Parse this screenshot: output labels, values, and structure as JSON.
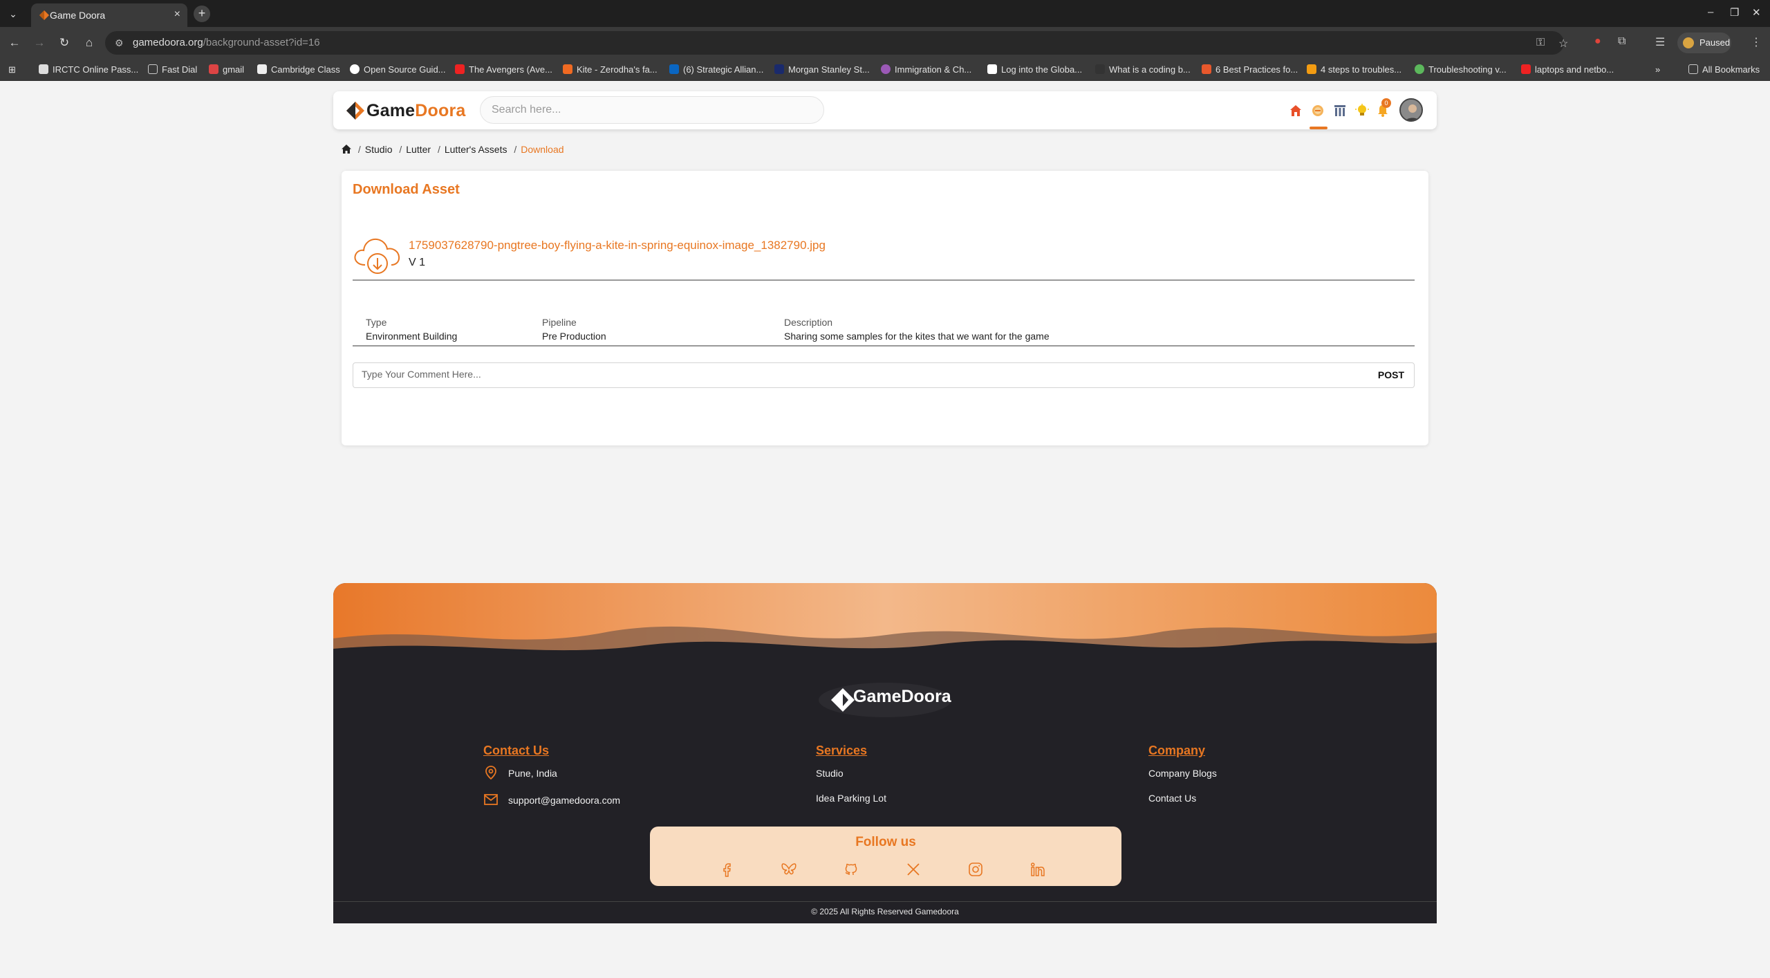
{
  "browser": {
    "tab_title": "Game Doora",
    "url_domain": "gamedoora.org",
    "url_path": "/background-asset?id=16",
    "profile_status": "Paused",
    "bookmarks": [
      "IRCTC Online Pass...",
      "Fast Dial",
      "gmail",
      "Cambridge Class",
      "Open Source Guid...",
      "The Avengers (Ave...",
      "Kite - Zerodha's fa...",
      "(6) Strategic Allian...",
      "Morgan Stanley St...",
      "Immigration & Ch...",
      "Log into the Globa...",
      "What is a coding b...",
      "6 Best Practices fo...",
      "4 steps to troubles...",
      "Troubleshooting v...",
      "laptops and netbo..."
    ],
    "all_bookmarks": "All Bookmarks"
  },
  "header": {
    "logo_part1": "Game",
    "logo_part2": "Doora",
    "search_placeholder": "Search here...",
    "notification_count": "0"
  },
  "breadcrumb": {
    "items": [
      "Studio",
      "Lutter",
      "Lutter's Assets"
    ],
    "current": "Download"
  },
  "asset": {
    "title": "Download Asset",
    "filename": "1759037628790-pngtree-boy-flying-a-kite-in-spring-equinox-image_1382790.jpg",
    "version": "V 1",
    "type_label": "Type",
    "type_value": "Environment Building",
    "pipeline_label": "Pipeline",
    "pipeline_value": "Pre Production",
    "description_label": "Description",
    "description_value": "Sharing some samples for the kites that we want for the game",
    "comment_placeholder": "Type Your Comment Here...",
    "post_label": "POST"
  },
  "footer": {
    "logo_text": "GameDoora",
    "contact_title": "Contact Us",
    "contact_location": "Pune, India",
    "contact_email": "support@gamedoora.com",
    "services_title": "Services",
    "services": [
      "Studio",
      "Idea Parking Lot"
    ],
    "company_title": "Company",
    "company": [
      "Company Blogs",
      "Contact Us"
    ],
    "follow_title": "Follow us",
    "copyright": "© 2025 All Rights Reserved Gamedoora"
  },
  "colors": {
    "accent": "#e87722",
    "footer_bg": "#222126",
    "follow_bg": "#f9dcc0"
  },
  "icons": {
    "header": [
      "home-icon",
      "idea-icon",
      "library-icon",
      "lightbulb-icon",
      "bell-icon"
    ],
    "social": [
      "facebook-icon",
      "bluesky-icon",
      "github-icon",
      "x-icon",
      "instagram-icon",
      "linkedin-icon"
    ]
  }
}
